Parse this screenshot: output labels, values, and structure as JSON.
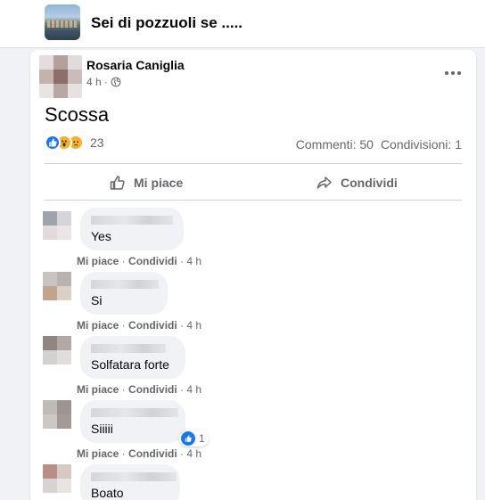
{
  "group": {
    "name": "Sei di pozzuoli se ....."
  },
  "post": {
    "author": "Rosaria Caniglia",
    "time": "4 h",
    "privacy_icon": "globe-icon",
    "text": "Scossa",
    "reaction_icons": [
      "like-icon",
      "wow-icon",
      "sad-icon"
    ],
    "reaction_count": "23",
    "comments": "Commenti: 50",
    "shares": "Condivisioni: 1"
  },
  "actions": {
    "like": "Mi piace",
    "share": "Condividi"
  },
  "comments": [
    {
      "text": "Yes",
      "like": "Mi piace",
      "share": "Condividi",
      "time": "4 h"
    },
    {
      "text": "Si",
      "like": "Mi piace",
      "share": "Condividi",
      "time": "4 h"
    },
    {
      "text": "Solfatara forte",
      "like": "Mi piace",
      "share": "Condividi",
      "time": "4 h"
    },
    {
      "text": "Siiiii",
      "like": "Mi piace",
      "share": "Condividi",
      "time": "4 h",
      "likes": "1"
    },
    {
      "text": "Boato"
    }
  ],
  "colors": {
    "accent": "#1877f2",
    "secondary_text": "#65676b",
    "bubble": "#f0f2f5"
  }
}
